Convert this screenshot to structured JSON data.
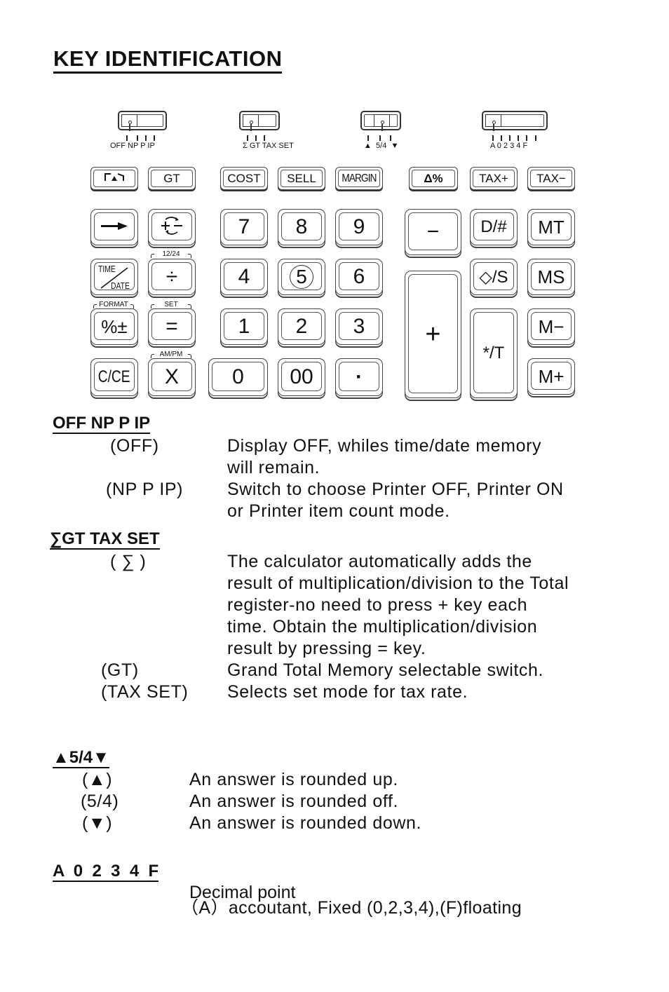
{
  "title": "KEY IDENTIFICATION",
  "switches": [
    {
      "name": "power-printer-switch",
      "labels": "OFF NP P IP"
    },
    {
      "name": "sigma-gt-tax-switch",
      "labels": "Σ GT TAX SET"
    },
    {
      "name": "rounding-switch",
      "labels_left": "▲",
      "labels_mid": "5/4",
      "labels_right": "▼"
    },
    {
      "name": "decimal-switch",
      "labels": "A 0 2 3 4 F"
    }
  ],
  "keys": {
    "paper_feed": "",
    "gt": "GT",
    "cost": "COST",
    "sell": "SELL",
    "margin": "MARGIN",
    "delta_percent": "Δ%",
    "tax_plus": "TAX+",
    "tax_minus": "TAX−",
    "backspace": "",
    "sign_change": "",
    "k7": "7",
    "k8": "8",
    "k9": "9",
    "minus": "−",
    "d_hash": "D/#",
    "mt": "MT",
    "time": "TIME",
    "date": "DATE",
    "divide": "÷",
    "k4": "4",
    "k5": "5",
    "k6": "6",
    "plus": "+",
    "diamond_s": "◇/S",
    "ms": "MS",
    "percent_pm": "%±",
    "equals": "=",
    "k1": "1",
    "k2": "2",
    "k3": "3",
    "star_t": "*/T",
    "m_minus": "M−",
    "c_ce": "C/CE",
    "multiply": "X",
    "k0": "0",
    "k00": "00",
    "dot": "·",
    "m_plus": "M+"
  },
  "key_tags": {
    "t1224": "12/24",
    "format": "FORMAT",
    "set": "SET",
    "ampm": "AM/PM"
  },
  "sections": {
    "power": {
      "heading": "OFF  NP  P  IP",
      "rows": [
        {
          "label": "(OFF)",
          "lines": [
            "Display OFF, whiles time/date memory",
            "will remain."
          ]
        },
        {
          "label": "(NP P IP)",
          "lines": [
            "Switch to choose Printer OFF, Printer ON",
            "or Printer item count mode."
          ]
        }
      ]
    },
    "sigma": {
      "heading": "∑GT  TAX SET",
      "rows": [
        {
          "label": "( ∑ )",
          "lines": [
            "The calculator automatically adds the",
            "result of multiplication/division to the Total",
            "register-no need to press + key each",
            "time. Obtain the multiplication/division",
            "result by pressing = key."
          ]
        },
        {
          "label": "(GT)",
          "lines": [
            "Grand Total Memory selectable switch."
          ]
        },
        {
          "label": "(TAX SET)",
          "lines": [
            "Selects set mode for tax rate."
          ]
        }
      ]
    },
    "rounding": {
      "heading": "▲5/4▼",
      "rows": [
        {
          "label": "(▲)",
          "text": "An answer is rounded up."
        },
        {
          "label": "(5/4)",
          "text": "An answer is rounded off."
        },
        {
          "label": "(▼)",
          "text": "An answer is rounded down."
        }
      ]
    },
    "decimal": {
      "heading": "A  0  2  3  4  F",
      "line1": "Decimal point",
      "line2": "（A）accoutant, Fixed (0,2,3,4),(F)floating"
    }
  }
}
